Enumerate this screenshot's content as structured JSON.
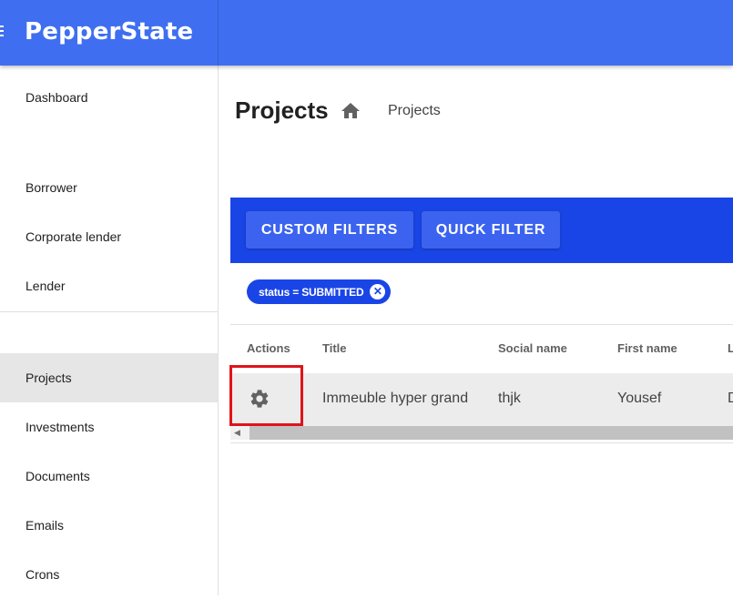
{
  "app": {
    "brand": "PepperState"
  },
  "sidebar": {
    "items": [
      {
        "label": "Dashboard"
      },
      {
        "label": "Borrower"
      },
      {
        "label": "Corporate lender"
      },
      {
        "label": "Lender"
      },
      {
        "label": "Projects",
        "active": true
      },
      {
        "label": "Investments"
      },
      {
        "label": "Documents"
      },
      {
        "label": "Emails"
      },
      {
        "label": "Crons"
      }
    ]
  },
  "header": {
    "title": "Projects",
    "breadcrumb": "Projects"
  },
  "filters": {
    "custom_label": "CUSTOM FILTERS",
    "quick_label": "QUICK FILTER",
    "active_chip": "status = SUBMITTED"
  },
  "table": {
    "columns": [
      "Actions",
      "Title",
      "Social name",
      "First name",
      "L"
    ],
    "rows": [
      {
        "title": "Immeuble hyper grand",
        "social_name": "thjk",
        "first_name": "Yousef",
        "last": "D"
      }
    ]
  },
  "icons": {
    "menu": "menu-icon",
    "home": "home-icon",
    "settings": "gear-icon",
    "close": "close-icon"
  },
  "colors": {
    "appbar": "#3f6ff0",
    "filterbar": "#1a45e6",
    "highlight": "#e0131b"
  }
}
